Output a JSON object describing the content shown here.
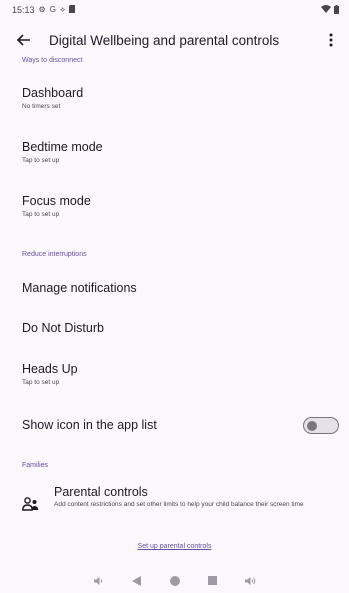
{
  "status_bar": {
    "time": "15:13",
    "g_label": "G",
    "icons": [
      "gear-icon",
      "google-g-icon",
      "location-icon",
      "sd-card-icon",
      "wifi-icon",
      "battery-icon"
    ]
  },
  "app_bar": {
    "title": "Digital Wellbeing and parental controls",
    "back_icon": "arrow-back-icon",
    "more_icon": "more-vert-icon"
  },
  "sections": {
    "ways_to_disconnect": "Ways to disconnect",
    "reduce_interruptions": "Reduce interruptions",
    "families": "Families"
  },
  "items": {
    "dashboard": {
      "title": "Dashboard",
      "summary": "No timers set"
    },
    "bedtime": {
      "title": "Bedtime mode",
      "summary": "Tap to set up"
    },
    "focus": {
      "title": "Focus mode",
      "summary": "Tap to set up"
    },
    "notifications": {
      "title": "Manage notifications"
    },
    "dnd": {
      "title": "Do Not Disturb"
    },
    "heads_up": {
      "title": "Heads Up",
      "summary": "Tap to set up"
    },
    "show_icon": {
      "title": "Show icon in the app list",
      "enabled": false
    }
  },
  "parental": {
    "title": "Parental controls",
    "summary": "Add content restrictions and set other limits to help your child balance their screen time",
    "link": "Set up parental controls",
    "icon": "family-icon"
  },
  "nav_bar": {
    "icons": [
      "volume-down-icon",
      "back-triangle-icon",
      "home-circle-icon",
      "recents-square-icon",
      "volume-up-icon"
    ]
  },
  "colors": {
    "background": "#fbf8fd",
    "accent": "#6750a4",
    "text_primary": "#1c1b1f",
    "text_secondary": "#49454f",
    "toggle_off": "#79747e"
  }
}
